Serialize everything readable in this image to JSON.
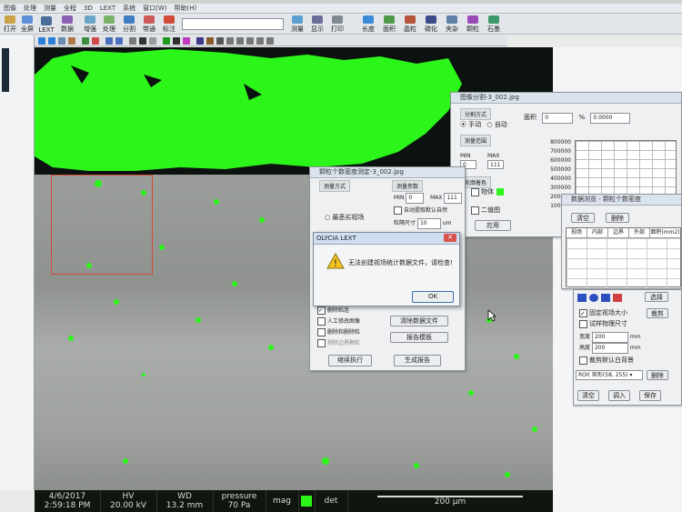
{
  "menu": [
    "图像",
    "处理",
    "测量",
    "全程",
    "3D",
    "LEXT",
    "系统",
    "窗口(W)",
    "帮助(H)"
  ],
  "toolbar": {
    "buttons": [
      "打开",
      "全屏",
      "LEXT",
      "数据",
      "增强",
      "处理",
      "分割",
      "带通",
      "标注",
      "测量",
      "显示",
      "打印",
      "长度",
      "面积",
      "晶粒",
      "碳化",
      "夹杂",
      "颗粒",
      "石墨"
    ]
  },
  "status": {
    "date": "4/6/2017",
    "time": "2:59:18 PM",
    "hv_label": "HV",
    "hv_value": "20.00 kV",
    "wd_label": "WD",
    "wd_value": "13.2 mm",
    "pressure_label": "pressure",
    "pressure_value": "70 Pa",
    "mag_label": "mag",
    "det_label": "det",
    "scale_text": "200 µm"
  },
  "seg_window": {
    "title": "图像分割-3_002.jpg",
    "section_method": "分割方式",
    "radio_manual": "手动",
    "radio_auto": "自动",
    "area_label": "面积",
    "area_value": "0",
    "percent_label": "%",
    "percent_value": "0.0000",
    "section_range": "测量范围",
    "min_label": "MIN",
    "min_value": "0",
    "max_label": "MAX",
    "max_value": "111",
    "section_style": "轮廓着色",
    "object_check": "物体",
    "binary_check": "二值图",
    "apply_button": "应用",
    "y_ticks": [
      "800000",
      "700000",
      "600000",
      "500000",
      "400000",
      "300000",
      "200000",
      "100000"
    ]
  },
  "particle_window": {
    "title": "颗粒个数密度测定-3_002.jpg",
    "section_measure": "测量方式",
    "radio_max_field": "最恶劣视场",
    "section_params": "测量参数",
    "min_label": "MIN",
    "min_value": "0",
    "max_label": "MAX",
    "max_value": "111",
    "auto_extract": "自动提取默认自然",
    "size_label": "粒隔尺寸",
    "size_value": "10",
    "size_unit": "um",
    "check_remove": "删除粘连",
    "check_manual": "人工修改图像",
    "check_delete_fine": "删除和删除粒",
    "check_edge": "剔除边界颗粒",
    "button_clear_data": "清除数据文件",
    "button_report_template": "报告模板",
    "button_continue": "继续执行",
    "button_report": "生成报告"
  },
  "message_box": {
    "title": "OLYCIA LEXT",
    "message": "无法创建视场统计数据文件，请检查!",
    "ok": "OK"
  },
  "data_window": {
    "title": "数据浏览 - 颗粒个数密度",
    "clear_button": "清空",
    "delete_button": "删除",
    "columns": [
      "视场",
      "内部",
      "边界",
      "外部",
      "面积(mm2)"
    ],
    "fix_field_check": "固定视场大小",
    "measure_check": "试样物理尺寸",
    "width_label": "宽度",
    "width_value": "200",
    "height_label": "高度",
    "height_value": "200",
    "unit": "mm",
    "clip_check": "裁剪默认白背景",
    "combo_value": "ROI( 矩形(58, 255) ▾",
    "delete_button2": "删除",
    "select_button": "选择",
    "crop_button": "裁剪",
    "clear_button2": "清空",
    "import_button": "调入",
    "save_button": "保存"
  },
  "colors": {
    "highlight_green": "#2cf51a",
    "image_dark": "#0c120f",
    "titlebar_blue": "#cfdff0",
    "warning_yellow": "#f3c321"
  }
}
